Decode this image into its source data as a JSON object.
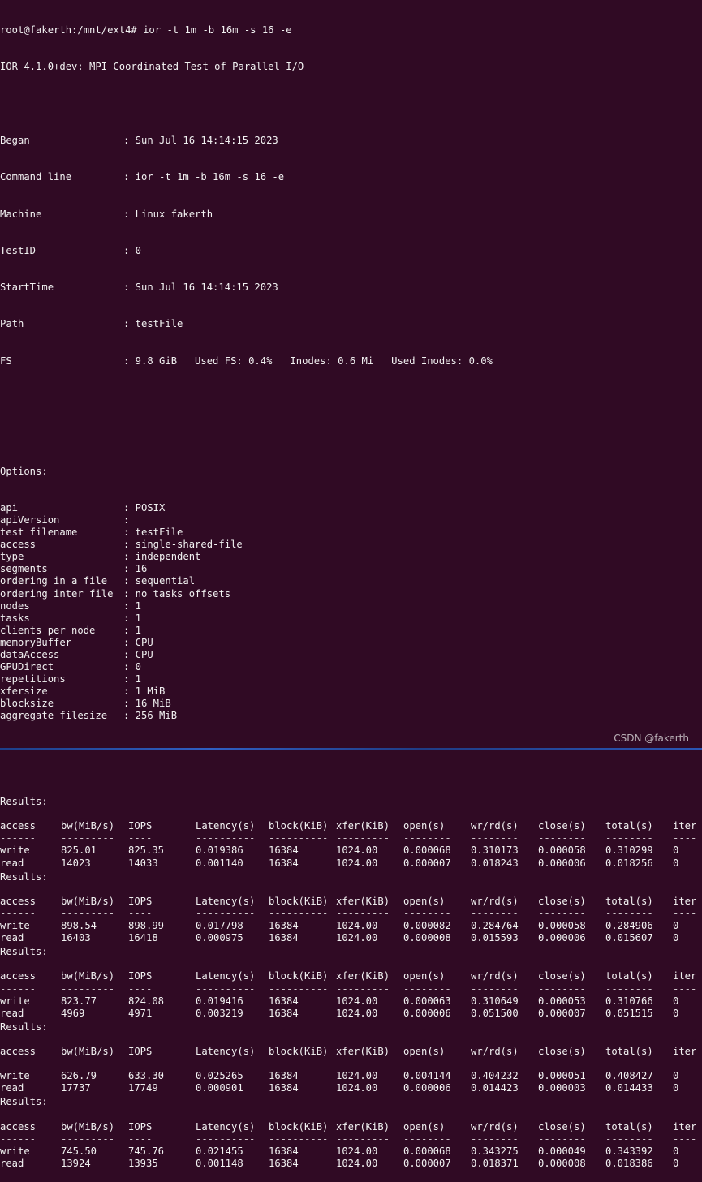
{
  "prompt": "root@fakerth:/mnt/ext4# ior -t 1m -b 16m -s 16 -e",
  "banner": "IOR-4.1.0+dev: MPI Coordinated Test of Parallel I/O",
  "header": [
    {
      "key": "Began",
      "value": ": Sun Jul 16 14:14:15 2023"
    },
    {
      "key": "Command line",
      "value": ": ior -t 1m -b 16m -s 16 -e"
    },
    {
      "key": "Machine",
      "value": ": Linux fakerth"
    },
    {
      "key": "TestID",
      "value": ": 0"
    },
    {
      "key": "StartTime",
      "value": ": Sun Jul 16 14:14:15 2023"
    },
    {
      "key": "Path",
      "value": ": testFile"
    },
    {
      "key": "FS",
      "value": ": 9.8 GiB   Used FS: 0.4%   Inodes: 0.6 Mi   Used Inodes: 0.0%"
    }
  ],
  "options_title": "Options:",
  "options": [
    {
      "key": "api",
      "value": ": POSIX"
    },
    {
      "key": "apiVersion",
      "value": ":"
    },
    {
      "key": "test filename",
      "value": ": testFile"
    },
    {
      "key": "access",
      "value": ": single-shared-file"
    },
    {
      "key": "type",
      "value": ": independent"
    },
    {
      "key": "segments",
      "value": ": 16"
    },
    {
      "key": "ordering in a file",
      "value": ": sequential"
    },
    {
      "key": "ordering inter file",
      "value": ": no tasks offsets"
    },
    {
      "key": "nodes",
      "value": ": 1"
    },
    {
      "key": "tasks",
      "value": ": 1"
    },
    {
      "key": "clients per node",
      "value": ": 1"
    },
    {
      "key": "memoryBuffer",
      "value": ": CPU"
    },
    {
      "key": "dataAccess",
      "value": ": CPU"
    },
    {
      "key": "GPUDirect",
      "value": ": 0"
    },
    {
      "key": "repetitions",
      "value": ": 1"
    },
    {
      "key": "xfersize",
      "value": ": 1 MiB"
    },
    {
      "key": "blocksize",
      "value": ": 16 MiB"
    },
    {
      "key": "aggregate filesize",
      "value": ": 256 MiB"
    }
  ],
  "results_title": "Results:",
  "columns": [
    "access",
    "bw(MiB/s)",
    "IOPS",
    "Latency(s)",
    "block(KiB)",
    "xfer(KiB)",
    "open(s)",
    "wr/rd(s)",
    "close(s)",
    "total(s)",
    "iter"
  ],
  "dashes": [
    "------",
    "---------",
    "----",
    "----------",
    "----------",
    "---------",
    "--------",
    "--------",
    "--------",
    "--------",
    "----"
  ],
  "results": [
    {
      "rows": [
        [
          "write",
          "825.01",
          "825.35",
          "0.019386",
          "16384",
          "1024.00",
          "0.000068",
          "0.310173",
          "0.000058",
          "0.310299",
          "0"
        ],
        [
          "read",
          "14023",
          "14033",
          "0.001140",
          "16384",
          "1024.00",
          "0.000007",
          "0.018243",
          "0.000006",
          "0.018256",
          "0"
        ]
      ]
    },
    {
      "rows": [
        [
          "write",
          "898.54",
          "898.99",
          "0.017798",
          "16384",
          "1024.00",
          "0.000082",
          "0.284764",
          "0.000058",
          "0.284906",
          "0"
        ],
        [
          "read",
          "16403",
          "16418",
          "0.000975",
          "16384",
          "1024.00",
          "0.000008",
          "0.015593",
          "0.000006",
          "0.015607",
          "0"
        ]
      ]
    },
    {
      "rows": [
        [
          "write",
          "823.77",
          "824.08",
          "0.019416",
          "16384",
          "1024.00",
          "0.000063",
          "0.310649",
          "0.000053",
          "0.310766",
          "0"
        ],
        [
          "read",
          "4969",
          "4971",
          "0.003219",
          "16384",
          "1024.00",
          "0.000006",
          "0.051500",
          "0.000007",
          "0.051515",
          "0"
        ]
      ]
    },
    {
      "rows": [
        [
          "write",
          "626.79",
          "633.30",
          "0.025265",
          "16384",
          "1024.00",
          "0.004144",
          "0.404232",
          "0.000051",
          "0.408427",
          "0"
        ],
        [
          "read",
          "17737",
          "17749",
          "0.000901",
          "16384",
          "1024.00",
          "0.000006",
          "0.014423",
          "0.000003",
          "0.014433",
          "0"
        ]
      ]
    },
    {
      "rows": [
        [
          "write",
          "745.50",
          "745.76",
          "0.021455",
          "16384",
          "1024.00",
          "0.000068",
          "0.343275",
          "0.000049",
          "0.343392",
          "0"
        ],
        [
          "read",
          "13924",
          "13935",
          "0.001148",
          "16384",
          "1024.00",
          "0.000007",
          "0.018371",
          "0.000008",
          "0.018386",
          "0"
        ]
      ]
    }
  ],
  "watermark": "CSDN @fakerth"
}
